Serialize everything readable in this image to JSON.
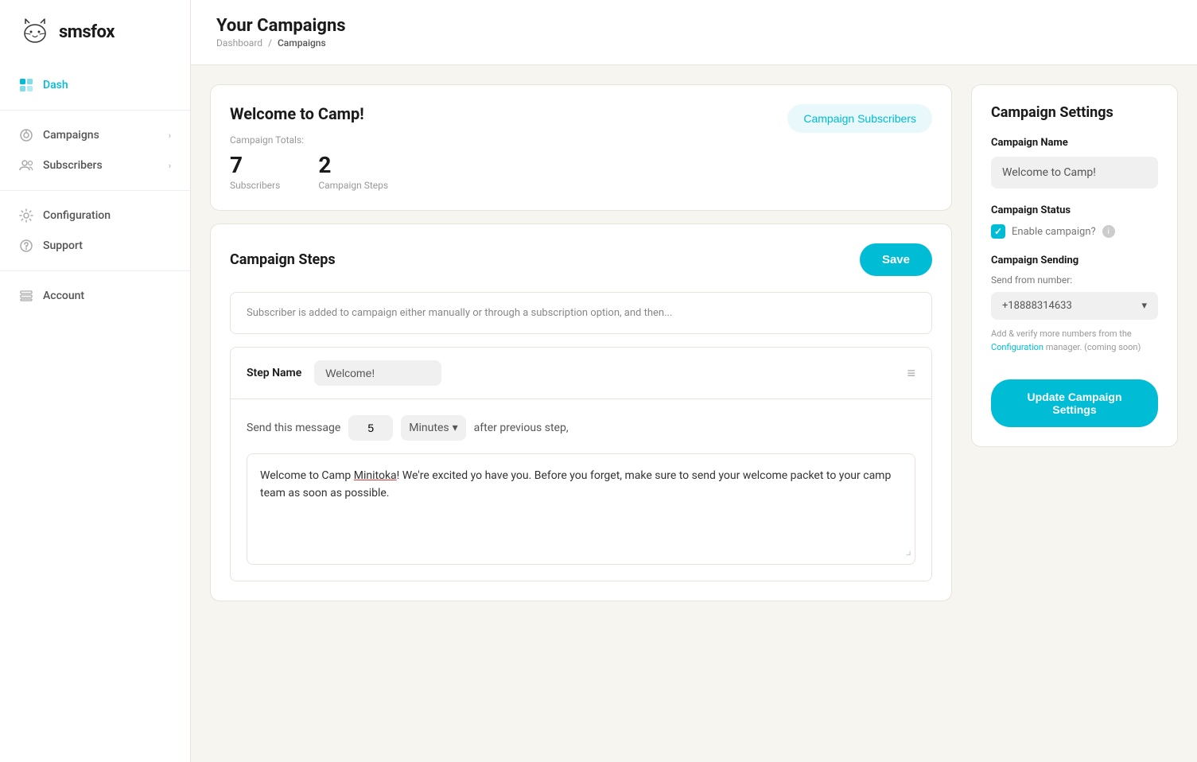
{
  "app": {
    "logo_text": "smsfox"
  },
  "sidebar": {
    "dash_label": "Dash",
    "nav_items": [
      {
        "id": "campaigns",
        "label": "Campaigns",
        "has_chevron": true
      },
      {
        "id": "subscribers",
        "label": "Subscribers",
        "has_chevron": true
      }
    ],
    "nav_items2": [
      {
        "id": "configuration",
        "label": "Configuration",
        "has_chevron": false
      },
      {
        "id": "support",
        "label": "Support",
        "has_chevron": false
      }
    ],
    "nav_items3": [
      {
        "id": "account",
        "label": "Account",
        "has_chevron": false
      }
    ]
  },
  "header": {
    "title": "Your Campaigns",
    "breadcrumb_root": "Dashboard",
    "breadcrumb_separator": "/",
    "breadcrumb_current": "Campaigns"
  },
  "campaign_card": {
    "title": "Welcome to Camp!",
    "subscribers_button": "Campaign Subscribers",
    "totals_label": "Campaign Totals:",
    "stat1_value": "7",
    "stat1_label": "Subscribers",
    "stat2_value": "2",
    "stat2_label": "Campaign Steps"
  },
  "steps_card": {
    "title": "Campaign Steps",
    "save_button": "Save",
    "info_text": "Subscriber is added to campaign either manually or through a subscription option, and then...",
    "step_name_label": "Step Name",
    "step_name_value": "Welcome!",
    "send_label": "Send this message",
    "delay_value": "5",
    "unit_value": "Minutes",
    "after_label": "after previous step,",
    "message_text": "Welcome to Camp Minitoka! We're excited yo have you. Before you forget, make sure to send your welcome packet to your camp team as soon as possible.",
    "minitoka_word": "Minitoka"
  },
  "settings_panel": {
    "title": "Campaign Settings",
    "name_label": "Campaign Name",
    "name_value": "Welcome to Camp!",
    "status_label": "Campaign Status",
    "enable_label": "Enable campaign?",
    "sending_label": "Campaign Sending",
    "send_from_label": "Send from number:",
    "phone_number": "+18888314633",
    "note_text": "Add & verify more numbers from the",
    "note_link": "Configuration",
    "note_suffix": "manager. (coming soon)",
    "update_button": "Update Campaign Settings"
  }
}
